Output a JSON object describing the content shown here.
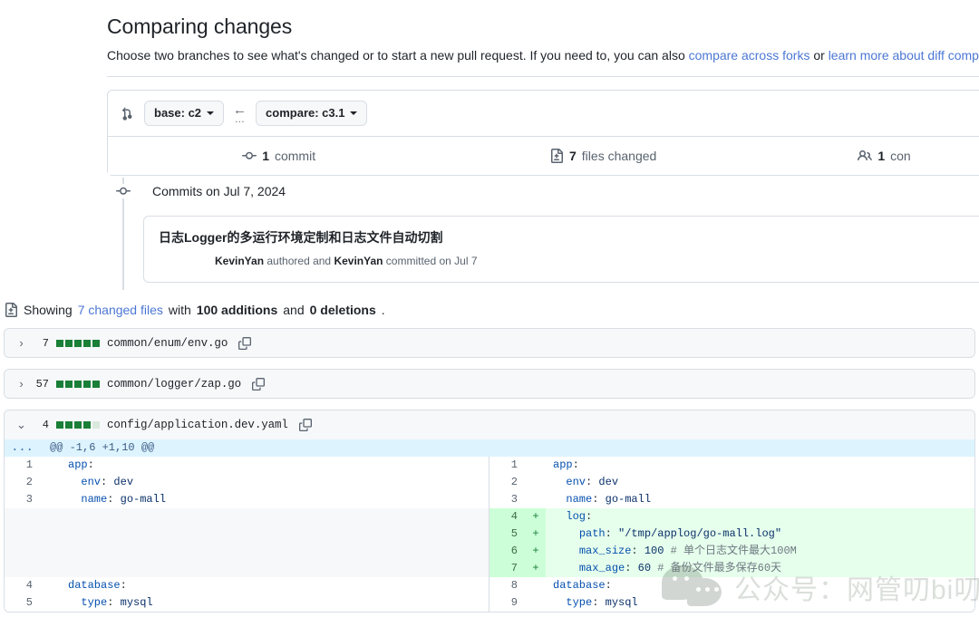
{
  "header": {
    "title": "Comparing changes",
    "subtitle_part1": "Choose two branches to see what's changed or to start a new pull request. If you need to, you can also ",
    "link_compare_forks": "compare across forks",
    "subtitle_part2": " or ",
    "link_learn_more": "learn more about diff compa"
  },
  "compare": {
    "compare_icon": "git-compare-icon",
    "base_label": "base: c2",
    "arrow": "←",
    "dots": "...",
    "compare_label": "compare: c3.1"
  },
  "stats": {
    "commits_icon": "commit-icon",
    "commits_count": "1",
    "commits_label": "commit",
    "files_icon": "file-diff-icon",
    "files_count": "7",
    "files_label": "files changed",
    "contributors_icon": "people-icon",
    "contributors_count": "1",
    "contributors_label": "con"
  },
  "commits": {
    "day_header": "Commits on Jul 7, 2024",
    "node_icon": "commit-node-icon",
    "items": [
      {
        "title": "日志Logger的多运行环境定制和日志文件自动切割",
        "author": "KevinYan",
        "meta_mid": " authored and ",
        "committer": "KevinYan",
        "meta_end": " committed on Jul 7"
      }
    ]
  },
  "showing": {
    "icon": "file-diff-icon",
    "prefix": "Showing ",
    "changed_files_link": "7 changed files",
    "mid": " with ",
    "additions": "100 additions",
    "and": " and ",
    "deletions": "0 deletions",
    "period": "."
  },
  "files": [
    {
      "expanded": false,
      "chevron": "›",
      "count": "7",
      "blocks_on": 5,
      "blocks_off": 0,
      "path": "common/enum/env.go",
      "copy_icon": "copy-icon"
    },
    {
      "expanded": false,
      "chevron": "›",
      "count": "57",
      "blocks_on": 5,
      "blocks_off": 0,
      "path": "common/logger/zap.go",
      "copy_icon": "copy-icon"
    },
    {
      "expanded": true,
      "chevron": "⌄",
      "count": "4",
      "blocks_on": 4,
      "blocks_off": 1,
      "path": "config/application.dev.yaml",
      "copy_icon": "copy-icon"
    }
  ],
  "diff": {
    "hunk_dots": "...",
    "hunk_header": "@@ -1,6 +1,10 @@",
    "left_rows": [
      {
        "type": "ctx",
        "num": "1",
        "mark": "",
        "code": "app:"
      },
      {
        "type": "ctx",
        "num": "2",
        "mark": "",
        "code": "  env: dev"
      },
      {
        "type": "ctx",
        "num": "3",
        "mark": "",
        "code": "  name: go-mall"
      },
      {
        "type": "blank",
        "num": "",
        "mark": "",
        "code": ""
      },
      {
        "type": "blank",
        "num": "",
        "mark": "",
        "code": ""
      },
      {
        "type": "blank",
        "num": "",
        "mark": "",
        "code": ""
      },
      {
        "type": "blank",
        "num": "",
        "mark": "",
        "code": ""
      },
      {
        "type": "ctx",
        "num": "4",
        "mark": "",
        "code": "database:"
      },
      {
        "type": "ctx",
        "num": "5",
        "mark": "",
        "code": "  type: mysql"
      }
    ],
    "right_rows": [
      {
        "type": "ctx",
        "num": "1",
        "mark": "",
        "code": "app:"
      },
      {
        "type": "ctx",
        "num": "2",
        "mark": "",
        "code": "  env: dev"
      },
      {
        "type": "ctx",
        "num": "3",
        "mark": "",
        "code": "  name: go-mall"
      },
      {
        "type": "add",
        "num": "4",
        "mark": "+",
        "code": "  log:"
      },
      {
        "type": "add",
        "num": "5",
        "mark": "+",
        "code": "    path: \"/tmp/applog/go-mall.log\""
      },
      {
        "type": "add",
        "num": "6",
        "mark": "+",
        "code": "    max_size: 100 # 单个日志文件最大100M"
      },
      {
        "type": "add",
        "num": "7",
        "mark": "+",
        "code": "    max_age: 60 # 备份文件最多保存60天"
      },
      {
        "type": "ctx",
        "num": "8",
        "mark": "",
        "code": "database:"
      },
      {
        "type": "ctx",
        "num": "9",
        "mark": "",
        "code": "  type: mysql"
      }
    ]
  },
  "watermark": {
    "text": "公众号：网管叨bi叨",
    "logo": "wechat-logo"
  },
  "colors": {
    "link": "#4c77d4",
    "green": "#1a7f37",
    "add_bg": "#e6ffec",
    "hunk_bg": "#ddf4ff",
    "border": "#d8dee4"
  }
}
